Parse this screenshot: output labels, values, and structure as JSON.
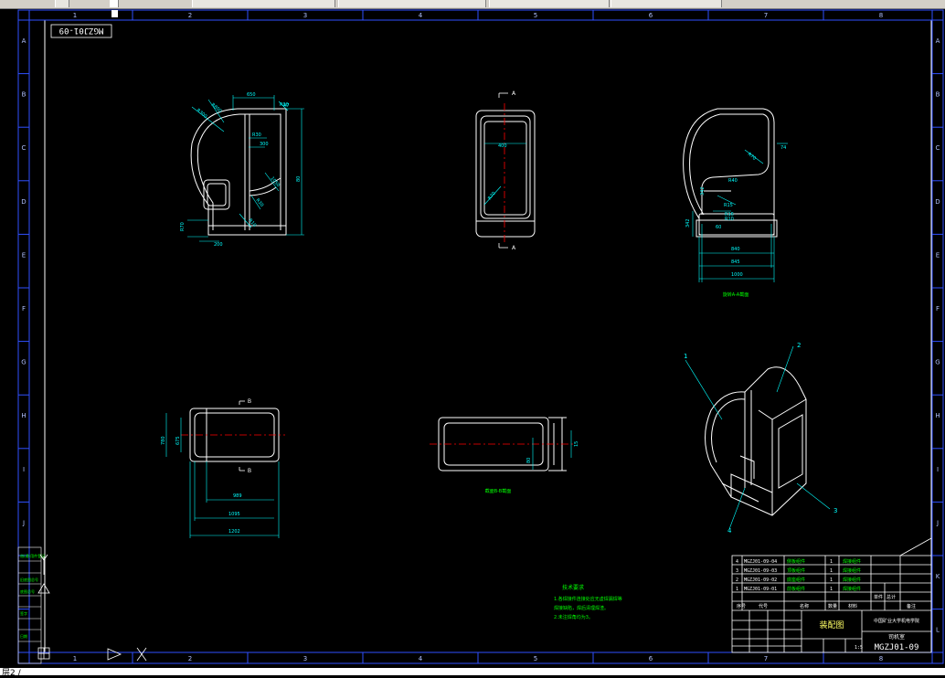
{
  "window": {
    "toolbar_segments": [
      "",
      "",
      "",
      "",
      "",
      ""
    ],
    "status_text": "层2 /"
  },
  "drawing": {
    "col_labels": [
      "1",
      "2",
      "3",
      "4",
      "5",
      "6",
      "7",
      "8"
    ],
    "row_labels": [
      "A",
      "B",
      "C",
      "D",
      "E",
      "F",
      "G",
      "H",
      "I",
      "J",
      "K",
      "L"
    ],
    "drawing_code_top": "MGZJ01-09",
    "section_aa_label": "旋转A-A截面",
    "section_bb_label": "截面B-B截面",
    "section_markers": {
      "a_top": "A",
      "a_bottom": "A",
      "b_top": "B",
      "b_bottom": "B"
    },
    "balloons": [
      "1",
      "2",
      "3",
      "4"
    ],
    "front_view_dims": [
      "650",
      "R90",
      "R300",
      "R800",
      "R30",
      "300",
      "80",
      "1050",
      "R30",
      "R10",
      "R70",
      "200",
      "A7"
    ],
    "side_view_dims": [
      "400",
      "R70"
    ],
    "section_view_dims": [
      "74",
      "R70",
      "R40",
      "342",
      "R15",
      "R16",
      "R10",
      "60",
      "342",
      "840",
      "845",
      "1000"
    ],
    "plan_view_dims": [
      "780",
      "675",
      "989",
      "1095",
      "1202"
    ],
    "bb_view_dims": [
      "15",
      "80"
    ],
    "notes": {
      "title": "技术要求",
      "lines": [
        "1.各焊接件连接处应无虚焊漏焊等",
        "焊接缺陷，焊后清理焊渣。",
        "2.未注焊角均为3。"
      ]
    },
    "title_block": {
      "parts": [
        {
          "no": "4",
          "code": "MGZJ01-09-04",
          "name": "侧板组件",
          "qty": "1",
          "material": "焊接组件"
        },
        {
          "no": "3",
          "code": "MGZJ01-09-03",
          "name": "顶板组件",
          "qty": "1",
          "material": "焊接组件"
        },
        {
          "no": "2",
          "code": "MGZJ01-09-02",
          "name": "底座组件",
          "qty": "1",
          "material": "焊接组件"
        },
        {
          "no": "1",
          "code": "MGZJ01-09-01",
          "name": "前板组件",
          "qty": "1",
          "material": "焊接组件"
        }
      ],
      "header": [
        "序号",
        "代号",
        "名称",
        "数量",
        "材料",
        "单件",
        "总计",
        "备注"
      ],
      "drawing_title": "装配图",
      "company": "中国矿业大学机电学院",
      "product": "司机室",
      "drawing_code": "MGZJ01-09",
      "scale": "1:5",
      "weight_label": "重量",
      "sheet_label": "比例"
    },
    "left_strip": [
      "借(通)用件登记",
      "旧底图总号",
      "底图总号",
      "签字",
      "日期"
    ]
  },
  "colors": {
    "background": "#000000",
    "outline": "#ffffff",
    "dimension": "#00ffff",
    "centerline": "#ff0000",
    "label": "#00ff00",
    "frame": "#3050ff",
    "ruler_text": "#b0c0ff"
  }
}
